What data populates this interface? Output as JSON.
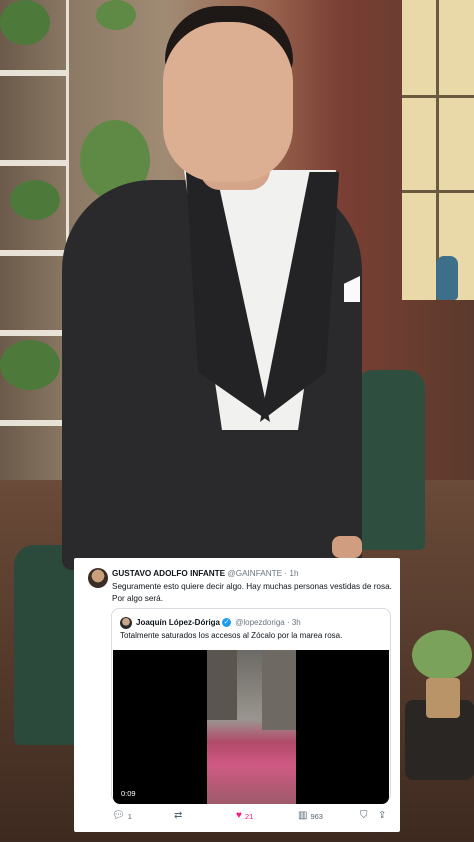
{
  "tweet": {
    "author_name": "GUSTAVO ADOLFO INFANTE",
    "author_handle": "@GAINFANTE",
    "separator": "·",
    "time": "1h",
    "text": "Seguramente esto quiere decir algo. Hay muchas personas vestidas de rosa. Por algo será.",
    "quote": {
      "author_name": "Joaquín López-Dóriga",
      "author_handle": "@lopezdoriga",
      "separator": "·",
      "time": "3h",
      "text": "Totalmente saturados los accesos al Zócalo por la marea rosa.",
      "video_duration": "0:09"
    },
    "actions": {
      "replies": "1",
      "retweets": "",
      "likes": "21",
      "views": "963"
    }
  },
  "icons": {
    "reply": "reply-icon",
    "retweet": "retweet-icon",
    "like": "heart-icon",
    "views": "views-icon",
    "bookmark": "bookmark-icon",
    "share": "share-icon"
  },
  "colors": {
    "like_active": "#f91880",
    "verified": "#1d9bf0"
  }
}
